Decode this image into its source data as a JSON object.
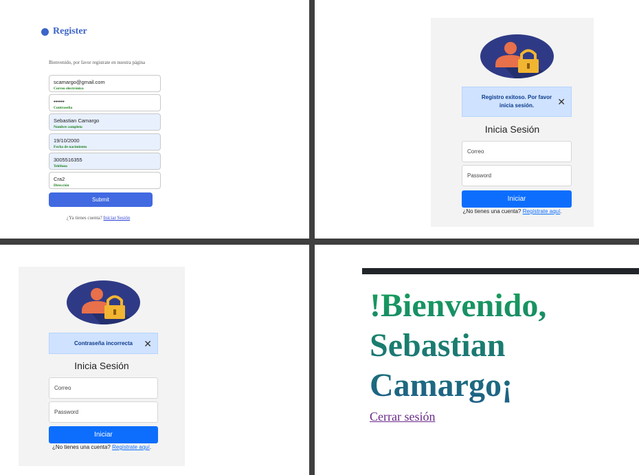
{
  "register": {
    "title": "Register",
    "intro": "Bienvenido, por favor registrate en nuestra página",
    "fields": [
      {
        "value": "scamargo@gmail.com",
        "label": "Correo electrónico"
      },
      {
        "value": "••••••",
        "label": "Contraseña"
      },
      {
        "value": "Sebastian Camargo",
        "label": "Nombre completo"
      },
      {
        "value": "19/10/2000",
        "label": "Fecha de nacimiento"
      },
      {
        "value": "3005516355",
        "label": "Teléfono"
      },
      {
        "value": "Cra2",
        "label": "Dirección"
      }
    ],
    "submit_label": "Submit",
    "footer_text": "¿Ya tienes cuenta?",
    "footer_link": "Iniciar Sesión"
  },
  "login_success": {
    "alert_line1": "Registro exitoso. Por favor",
    "alert_line2": "inicia sesión.",
    "close_glyph": "✕",
    "title": "Inicia Sesión",
    "email_placeholder": "Correo",
    "password_placeholder": "Password",
    "button_label": "Iniciar",
    "footer_text": "¿No tienes una cuenta?",
    "footer_link": "Regístrate aquí",
    "footer_end": "."
  },
  "login_error": {
    "alert": "Contraseña incorrecta",
    "close_glyph": "✕",
    "title": "Inicia Sesión",
    "email_placeholder": "Correo",
    "password_placeholder": "Password",
    "button_label": "Iniciar",
    "footer_text": "¿No tienes una cuenta?",
    "footer_link": "Regístrate aquí",
    "footer_end": "."
  },
  "welcome": {
    "line1": "!Bienvenido,",
    "line2": "Sebastian",
    "line3": "Camargo¡",
    "logout_label": "Cerrar sesión"
  },
  "colors": {
    "primary": "#0d6efd",
    "register_accent": "#4169e1",
    "alert_bg": "#cfe2ff",
    "label_green": "#1a7f1a",
    "divider": "#3f3f3f"
  },
  "icons": [
    "user-lock-icon",
    "close-icon"
  ]
}
